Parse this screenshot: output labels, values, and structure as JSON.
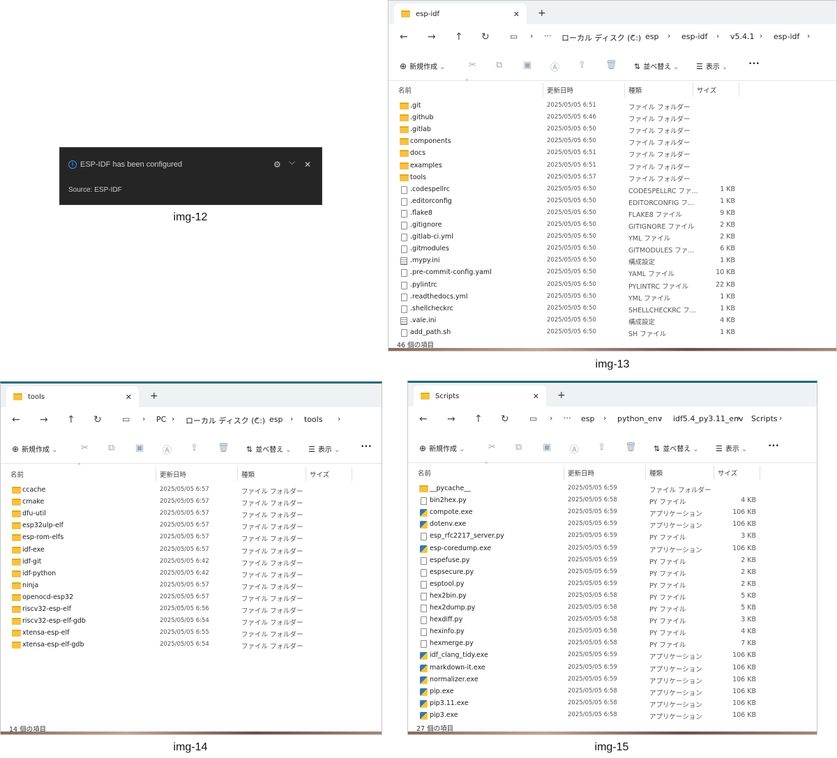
{
  "toast": {
    "message": "ESP-IDF has been configured",
    "source": "Source: ESP-IDF",
    "info_glyph": "i",
    "gear_glyph": "⚙",
    "chevron_glyph": "⌵",
    "close_glyph": "✕"
  },
  "captions": {
    "img12": "img-12",
    "img13": "img-13",
    "img14": "img-14",
    "img15": "img-15"
  },
  "common": {
    "new_label": "新規作成",
    "sort_label": "並べ替え",
    "view_label": "表示",
    "more_glyph": "•••",
    "col_name": "名前",
    "col_date": "更新日時",
    "col_type": "種類",
    "col_size": "サイズ",
    "back_glyph": "←",
    "forward_glyph": "→",
    "up_glyph": "↑",
    "refresh_glyph": "↻",
    "close_glyph": "✕",
    "plus_glyph": "+",
    "chevron_glyph": "›",
    "dots_glyph": "···",
    "dropdown_glyph": "⌄",
    "sort_up_glyph": "˄"
  },
  "win13": {
    "tab": "esp-idf",
    "crumbs": [
      "ローカル ディスク (C:)",
      "esp",
      "esp-idf",
      "v5.4.1",
      "esp-idf"
    ],
    "status": "46 個の項目",
    "rows": [
      {
        "icon": "folder",
        "name": ".git",
        "date": "2025/05/05 6:51",
        "type": "ファイル フォルダー",
        "size": ""
      },
      {
        "icon": "folder",
        "name": ".github",
        "date": "2025/05/05 6:46",
        "type": "ファイル フォルダー",
        "size": ""
      },
      {
        "icon": "folder",
        "name": ".gitlab",
        "date": "2025/05/05 6:50",
        "type": "ファイル フォルダー",
        "size": ""
      },
      {
        "icon": "folder",
        "name": "components",
        "date": "2025/05/05 6:50",
        "type": "ファイル フォルダー",
        "size": ""
      },
      {
        "icon": "folder",
        "name": "docs",
        "date": "2025/05/05 6:51",
        "type": "ファイル フォルダー",
        "size": ""
      },
      {
        "icon": "folder",
        "name": "examples",
        "date": "2025/05/05 6:51",
        "type": "ファイル フォルダー",
        "size": ""
      },
      {
        "icon": "folder",
        "name": "tools",
        "date": "2025/05/05 6:57",
        "type": "ファイル フォルダー",
        "size": ""
      },
      {
        "icon": "file",
        "name": ".codespellrc",
        "date": "2025/05/05 6:50",
        "type": "CODESPELLRC ファ...",
        "size": "1 KB"
      },
      {
        "icon": "file",
        "name": ".editorconfig",
        "date": "2025/05/05 6:50",
        "type": "EDITORCONFIG フ...",
        "size": "1 KB"
      },
      {
        "icon": "file",
        "name": ".flake8",
        "date": "2025/05/05 6:50",
        "type": "FLAKE8 ファイル",
        "size": "9 KB"
      },
      {
        "icon": "file",
        "name": ".gitignore",
        "date": "2025/05/05 6:50",
        "type": "GITIGNORE ファイル",
        "size": "2 KB"
      },
      {
        "icon": "file",
        "name": ".gitlab-ci.yml",
        "date": "2025/05/05 6:50",
        "type": "YML ファイル",
        "size": "2 KB"
      },
      {
        "icon": "file",
        "name": ".gitmodules",
        "date": "2025/05/05 6:50",
        "type": "GITMODULES ファ...",
        "size": "6 KB"
      },
      {
        "icon": "cfg",
        "name": ".mypy.ini",
        "date": "2025/05/05 6:50",
        "type": "構成設定",
        "size": "1 KB"
      },
      {
        "icon": "file",
        "name": ".pre-commit-config.yaml",
        "date": "2025/05/05 6:50",
        "type": "YAML ファイル",
        "size": "10 KB"
      },
      {
        "icon": "file",
        "name": ".pylintrc",
        "date": "2025/05/05 6:50",
        "type": "PYLINTRC ファイル",
        "size": "22 KB"
      },
      {
        "icon": "file",
        "name": ".readthedocs.yml",
        "date": "2025/05/05 6:50",
        "type": "YML ファイル",
        "size": "1 KB"
      },
      {
        "icon": "file",
        "name": ".shellcheckrc",
        "date": "2025/05/05 6:50",
        "type": "SHELLCHECKRC フ...",
        "size": "1 KB"
      },
      {
        "icon": "cfg",
        "name": ".vale.ini",
        "date": "2025/05/05 6:50",
        "type": "構成設定",
        "size": "4 KB"
      },
      {
        "icon": "file",
        "name": "add_path.sh",
        "date": "2025/05/05 6:50",
        "type": "SH ファイル",
        "size": "1 KB"
      }
    ]
  },
  "win14": {
    "tab": "tools",
    "crumbs": [
      "PC",
      "ローカル ディスク (C:)",
      "esp",
      "tools"
    ],
    "status": "14 個の項目",
    "rows": [
      {
        "icon": "folder",
        "name": "ccache",
        "date": "2025/05/05 6:57",
        "type": "ファイル フォルダー",
        "size": ""
      },
      {
        "icon": "folder",
        "name": "cmake",
        "date": "2025/05/05 6:57",
        "type": "ファイル フォルダー",
        "size": ""
      },
      {
        "icon": "folder",
        "name": "dfu-util",
        "date": "2025/05/05 6:57",
        "type": "ファイル フォルダー",
        "size": ""
      },
      {
        "icon": "folder",
        "name": "esp32ulp-elf",
        "date": "2025/05/05 6:57",
        "type": "ファイル フォルダー",
        "size": ""
      },
      {
        "icon": "folder",
        "name": "esp-rom-elfs",
        "date": "2025/05/05 6:57",
        "type": "ファイル フォルダー",
        "size": ""
      },
      {
        "icon": "folder",
        "name": "idf-exe",
        "date": "2025/05/05 6:57",
        "type": "ファイル フォルダー",
        "size": ""
      },
      {
        "icon": "folder",
        "name": "idf-git",
        "date": "2025/05/05 6:42",
        "type": "ファイル フォルダー",
        "size": ""
      },
      {
        "icon": "folder",
        "name": "idf-python",
        "date": "2025/05/05 6:42",
        "type": "ファイル フォルダー",
        "size": ""
      },
      {
        "icon": "folder",
        "name": "ninja",
        "date": "2025/05/05 6:57",
        "type": "ファイル フォルダー",
        "size": ""
      },
      {
        "icon": "folder",
        "name": "openocd-esp32",
        "date": "2025/05/05 6:57",
        "type": "ファイル フォルダー",
        "size": ""
      },
      {
        "icon": "folder",
        "name": "riscv32-esp-elf",
        "date": "2025/05/05 6:56",
        "type": "ファイル フォルダー",
        "size": ""
      },
      {
        "icon": "folder",
        "name": "riscv32-esp-elf-gdb",
        "date": "2025/05/05 6:54",
        "type": "ファイル フォルダー",
        "size": ""
      },
      {
        "icon": "folder",
        "name": "xtensa-esp-elf",
        "date": "2025/05/05 6:55",
        "type": "ファイル フォルダー",
        "size": ""
      },
      {
        "icon": "folder",
        "name": "xtensa-esp-elf-gdb",
        "date": "2025/05/05 6:54",
        "type": "ファイル フォルダー",
        "size": ""
      }
    ]
  },
  "win15": {
    "tab": "Scripts",
    "crumbs": [
      "esp",
      "python_env",
      "idf5.4_py3.11_env",
      "Scripts"
    ],
    "status": "27 個の項目",
    "rows": [
      {
        "icon": "folder",
        "name": "__pycache__",
        "date": "2025/05/05 6:59",
        "type": "ファイル フォルダー",
        "size": ""
      },
      {
        "icon": "file",
        "name": "bin2hex.py",
        "date": "2025/05/05 6:58",
        "type": "PY ファイル",
        "size": "4 KB"
      },
      {
        "icon": "py",
        "name": "compote.exe",
        "date": "2025/05/05 6:59",
        "type": "アプリケーション",
        "size": "106 KB"
      },
      {
        "icon": "py",
        "name": "dotenv.exe",
        "date": "2025/05/05 6:59",
        "type": "アプリケーション",
        "size": "106 KB"
      },
      {
        "icon": "file",
        "name": "esp_rfc2217_server.py",
        "date": "2025/05/05 6:59",
        "type": "PY ファイル",
        "size": "3 KB"
      },
      {
        "icon": "py",
        "name": "esp-coredump.exe",
        "date": "2025/05/05 6:59",
        "type": "アプリケーション",
        "size": "106 KB"
      },
      {
        "icon": "file",
        "name": "espefuse.py",
        "date": "2025/05/05 6:59",
        "type": "PY ファイル",
        "size": "2 KB"
      },
      {
        "icon": "file",
        "name": "espsecure.py",
        "date": "2025/05/05 6:59",
        "type": "PY ファイル",
        "size": "2 KB"
      },
      {
        "icon": "file",
        "name": "esptool.py",
        "date": "2025/05/05 6:59",
        "type": "PY ファイル",
        "size": "2 KB"
      },
      {
        "icon": "file",
        "name": "hex2bin.py",
        "date": "2025/05/05 6:58",
        "type": "PY ファイル",
        "size": "5 KB"
      },
      {
        "icon": "file",
        "name": "hex2dump.py",
        "date": "2025/05/05 6:58",
        "type": "PY ファイル",
        "size": "5 KB"
      },
      {
        "icon": "file",
        "name": "hexdiff.py",
        "date": "2025/05/05 6:58",
        "type": "PY ファイル",
        "size": "3 KB"
      },
      {
        "icon": "file",
        "name": "hexinfo.py",
        "date": "2025/05/05 6:58",
        "type": "PY ファイル",
        "size": "4 KB"
      },
      {
        "icon": "file",
        "name": "hexmerge.py",
        "date": "2025/05/05 6:58",
        "type": "PY ファイル",
        "size": "7 KB"
      },
      {
        "icon": "py",
        "name": "idf_clang_tidy.exe",
        "date": "2025/05/05 6:59",
        "type": "アプリケーション",
        "size": "106 KB"
      },
      {
        "icon": "py",
        "name": "markdown-it.exe",
        "date": "2025/05/05 6:59",
        "type": "アプリケーション",
        "size": "106 KB"
      },
      {
        "icon": "py",
        "name": "normalizer.exe",
        "date": "2025/05/05 6:59",
        "type": "アプリケーション",
        "size": "106 KB"
      },
      {
        "icon": "py",
        "name": "pip.exe",
        "date": "2025/05/05 6:58",
        "type": "アプリケーション",
        "size": "106 KB"
      },
      {
        "icon": "py",
        "name": "pip3.11.exe",
        "date": "2025/05/05 6:58",
        "type": "アプリケーション",
        "size": "106 KB"
      },
      {
        "icon": "py",
        "name": "pip3.exe",
        "date": "2025/05/05 6:58",
        "type": "アプリケーション",
        "size": "106 KB"
      }
    ]
  }
}
